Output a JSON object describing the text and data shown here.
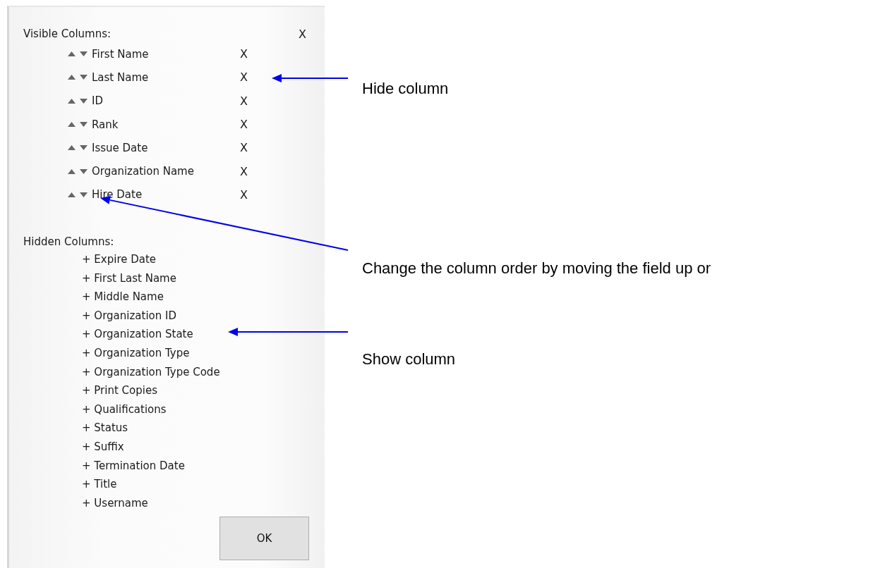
{
  "dialog": {
    "visible_title": "Visible Columns:",
    "close": "X",
    "visible_columns": [
      {
        "name": "First Name",
        "remove": "X"
      },
      {
        "name": "Last Name",
        "remove": "X"
      },
      {
        "name": "ID",
        "remove": "X"
      },
      {
        "name": "Rank",
        "remove": "X"
      },
      {
        "name": "Issue Date",
        "remove": "X"
      },
      {
        "name": "Organization Name",
        "remove": "X"
      },
      {
        "name": "Hire Date",
        "remove": "X"
      }
    ],
    "hidden_title": "Hidden Columns:",
    "hidden_columns": [
      "+ Expire Date",
      "+ First Last Name",
      "+ Middle Name",
      "+ Organization ID",
      "+ Organization State",
      "+ Organization Type",
      "+ Organization Type Code",
      "+ Print Copies",
      "+ Qualifications",
      "+ Status",
      "+ Suffix",
      "+ Termination Date",
      "+ Title",
      "+ Username"
    ],
    "ok": "OK"
  },
  "annotations": [
    {
      "text": "Hide column",
      "kind": "remove"
    },
    {
      "text": "Change the column order by moving the field up or",
      "kind": "order"
    },
    {
      "text": "Show column",
      "kind": "show"
    }
  ]
}
